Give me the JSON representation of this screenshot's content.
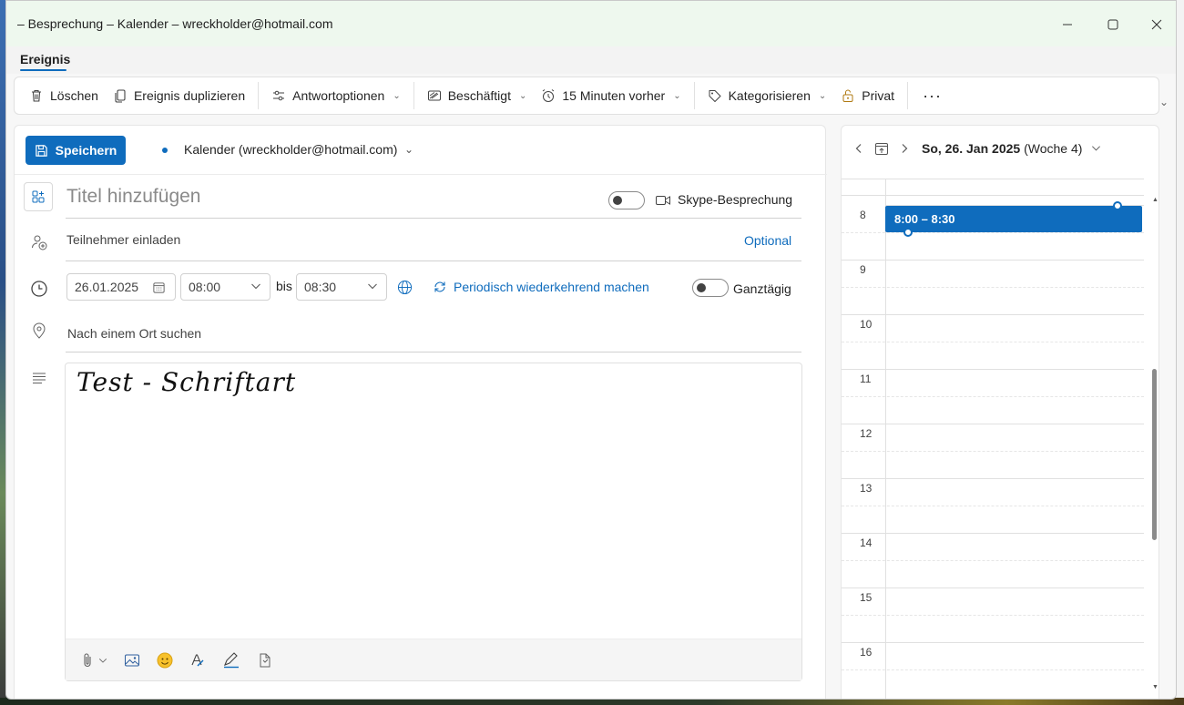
{
  "window": {
    "title": "– Besprechung – Kalender – wreckholder@hotmail.com"
  },
  "ribbon": {
    "active_tab": "Ereignis"
  },
  "toolbar": {
    "delete": "Löschen",
    "duplicate": "Ereignis duplizieren",
    "response_options": "Antwortoptionen",
    "show_as": "Beschäftigt",
    "reminder": "15 Minuten vorher",
    "categorize": "Kategorisieren",
    "private": "Privat",
    "more": "···"
  },
  "form": {
    "save_label": "Speichern",
    "calendar": "Kalender (wreckholder@hotmail.com)",
    "title_placeholder": "Titel hinzufügen",
    "skype_label": "Skype-Besprechung",
    "attendees_placeholder": "Teilnehmer einladen",
    "optional_label": "Optional",
    "start_date": "26.01.2025",
    "start_time": "08:00",
    "to_label": "bis",
    "end_time": "08:30",
    "recurring_label": "Periodisch wiederkehrend machen",
    "all_day_label": "Ganztägig",
    "location_placeholder": "Nach einem Ort suchen",
    "body_text": "Test - Schriftart"
  },
  "day_view": {
    "date_bold": "So, 26. Jan 2025",
    "week": "(Woche 4)",
    "hours": [
      "8",
      "9",
      "10",
      "11",
      "12",
      "13",
      "14",
      "15",
      "16"
    ],
    "event_label": "8:00 – 8:30"
  },
  "colors": {
    "accent": "#0f6cbd",
    "titlebar_bg": "#eef8ee"
  }
}
